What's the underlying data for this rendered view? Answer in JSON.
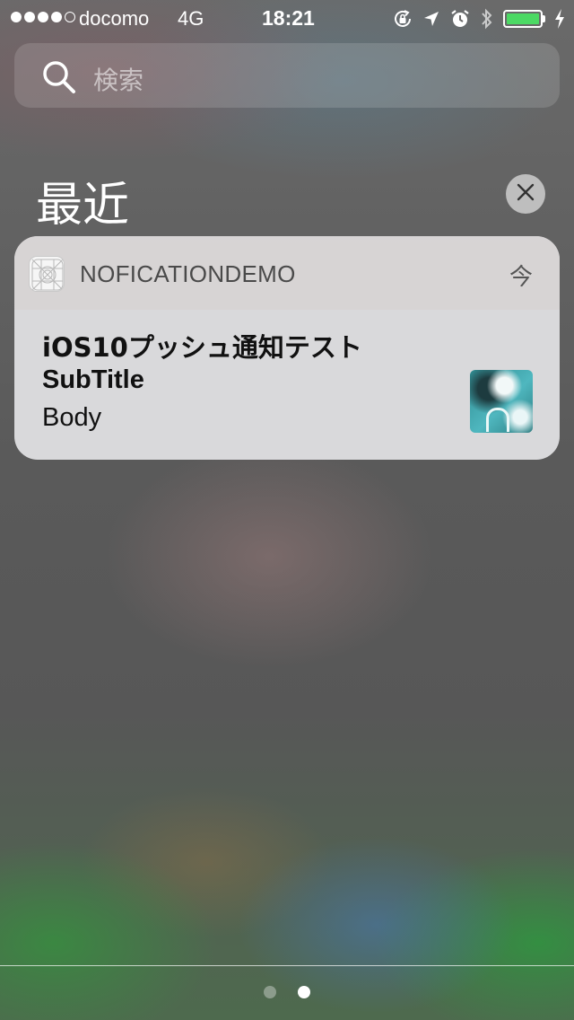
{
  "status_bar": {
    "signal_bars": 4,
    "signal_total": 5,
    "carrier": "docomo",
    "network": "4G",
    "time": "18:21",
    "battery_level_pct": 100,
    "battery_color": "#4cd964"
  },
  "search": {
    "placeholder": "検索"
  },
  "section": {
    "title": "最近"
  },
  "notification": {
    "app_name": "NOFICATIONDEMO",
    "time": "今",
    "title": "iOS10プッシュ通知テスト",
    "subtitle": "SubTitle",
    "body": "Body"
  },
  "page_indicator": {
    "pages": 2,
    "current_page": 2
  }
}
